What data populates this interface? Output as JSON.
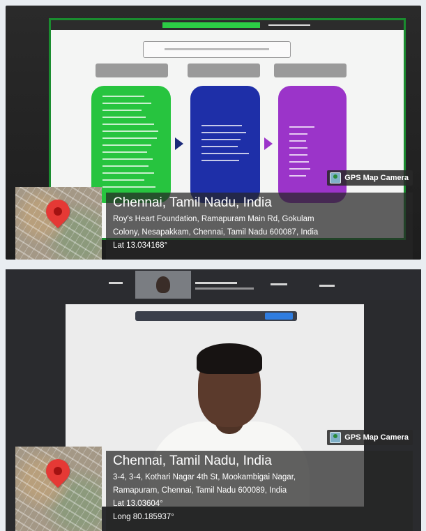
{
  "photos": [
    {
      "gps_badge": "GPS Map Camera",
      "city": "Chennai, Tamil Nadu, India",
      "address_line1": "Roy's Heart Foundation, Ramapuram Main Rd, Gokulam",
      "address_line2": "Colony, Nesapakkam, Chennai, Tamil Nadu 600087, India",
      "lat": "Lat 13.034168°"
    },
    {
      "gps_badge": "GPS Map Camera",
      "city": "Chennai, Tamil Nadu, India",
      "address_line1": "3-4, 3-4, Kothari Nagar 4th St, Mookambigai Nagar,",
      "address_line2": "Ramapuram, Chennai, Tamil Nadu 600089, India",
      "lat": "Lat 13.03604°",
      "long": "Long 80.185937°"
    }
  ],
  "icons": {
    "pin": "location-pin-icon",
    "badge": "gps-map-camera-icon"
  },
  "colors": {
    "card_green": "#27c43f",
    "card_blue": "#1e2fa8",
    "card_purple": "#9b34c9",
    "pin_red": "#e53935"
  }
}
